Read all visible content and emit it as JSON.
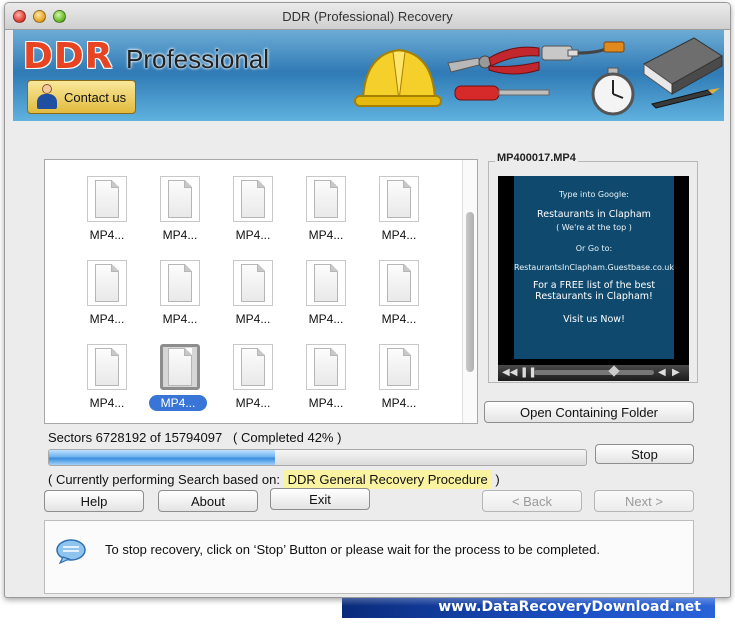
{
  "window": {
    "title": "DDR (Professional) Recovery"
  },
  "banner": {
    "logo_ddr": "DDR",
    "logo_professional": "Professional",
    "contact_label": "Contact us"
  },
  "files": [
    {
      "name": "MP4..."
    },
    {
      "name": "MP4..."
    },
    {
      "name": "MP4..."
    },
    {
      "name": "MP4..."
    },
    {
      "name": "MP4..."
    },
    {
      "name": "MP4..."
    },
    {
      "name": "MP4..."
    },
    {
      "name": "MP4..."
    },
    {
      "name": "MP4..."
    },
    {
      "name": "MP4..."
    },
    {
      "name": "MP4..."
    },
    {
      "name": "MP4...",
      "selected": true
    },
    {
      "name": "MP4..."
    },
    {
      "name": "MP4..."
    },
    {
      "name": "MP4..."
    }
  ],
  "preview": {
    "title": "MP400017.MP4",
    "lines": [
      "Type into Google:",
      "Restaurants in Clapham",
      "( We're at the top )",
      "Or Go to:",
      "RestaurantsInClapham.Guestbase.co.uk",
      "For a FREE list of the best Restaurants in Clapham!",
      "Visit us Now!"
    ],
    "open_folder_label": "Open Containing Folder"
  },
  "progress": {
    "sectors_text": "Sectors 6728192 of 15794097",
    "completed_text": "( Completed 42% )",
    "fraction": 0.42,
    "stop_label": "Stop"
  },
  "status": {
    "prefix": "( Currently performing Search based on:",
    "procedure": "DDR General Recovery Procedure",
    "suffix": ")"
  },
  "buttons": {
    "help": "Help",
    "about": "About",
    "exit": "Exit",
    "back": "< Back",
    "next": "Next >"
  },
  "info": {
    "message": "To stop recovery, click on ‘Stop’ Button or please wait for the process to be completed."
  },
  "footer": {
    "url": "www.DataRecoveryDownload.net"
  }
}
